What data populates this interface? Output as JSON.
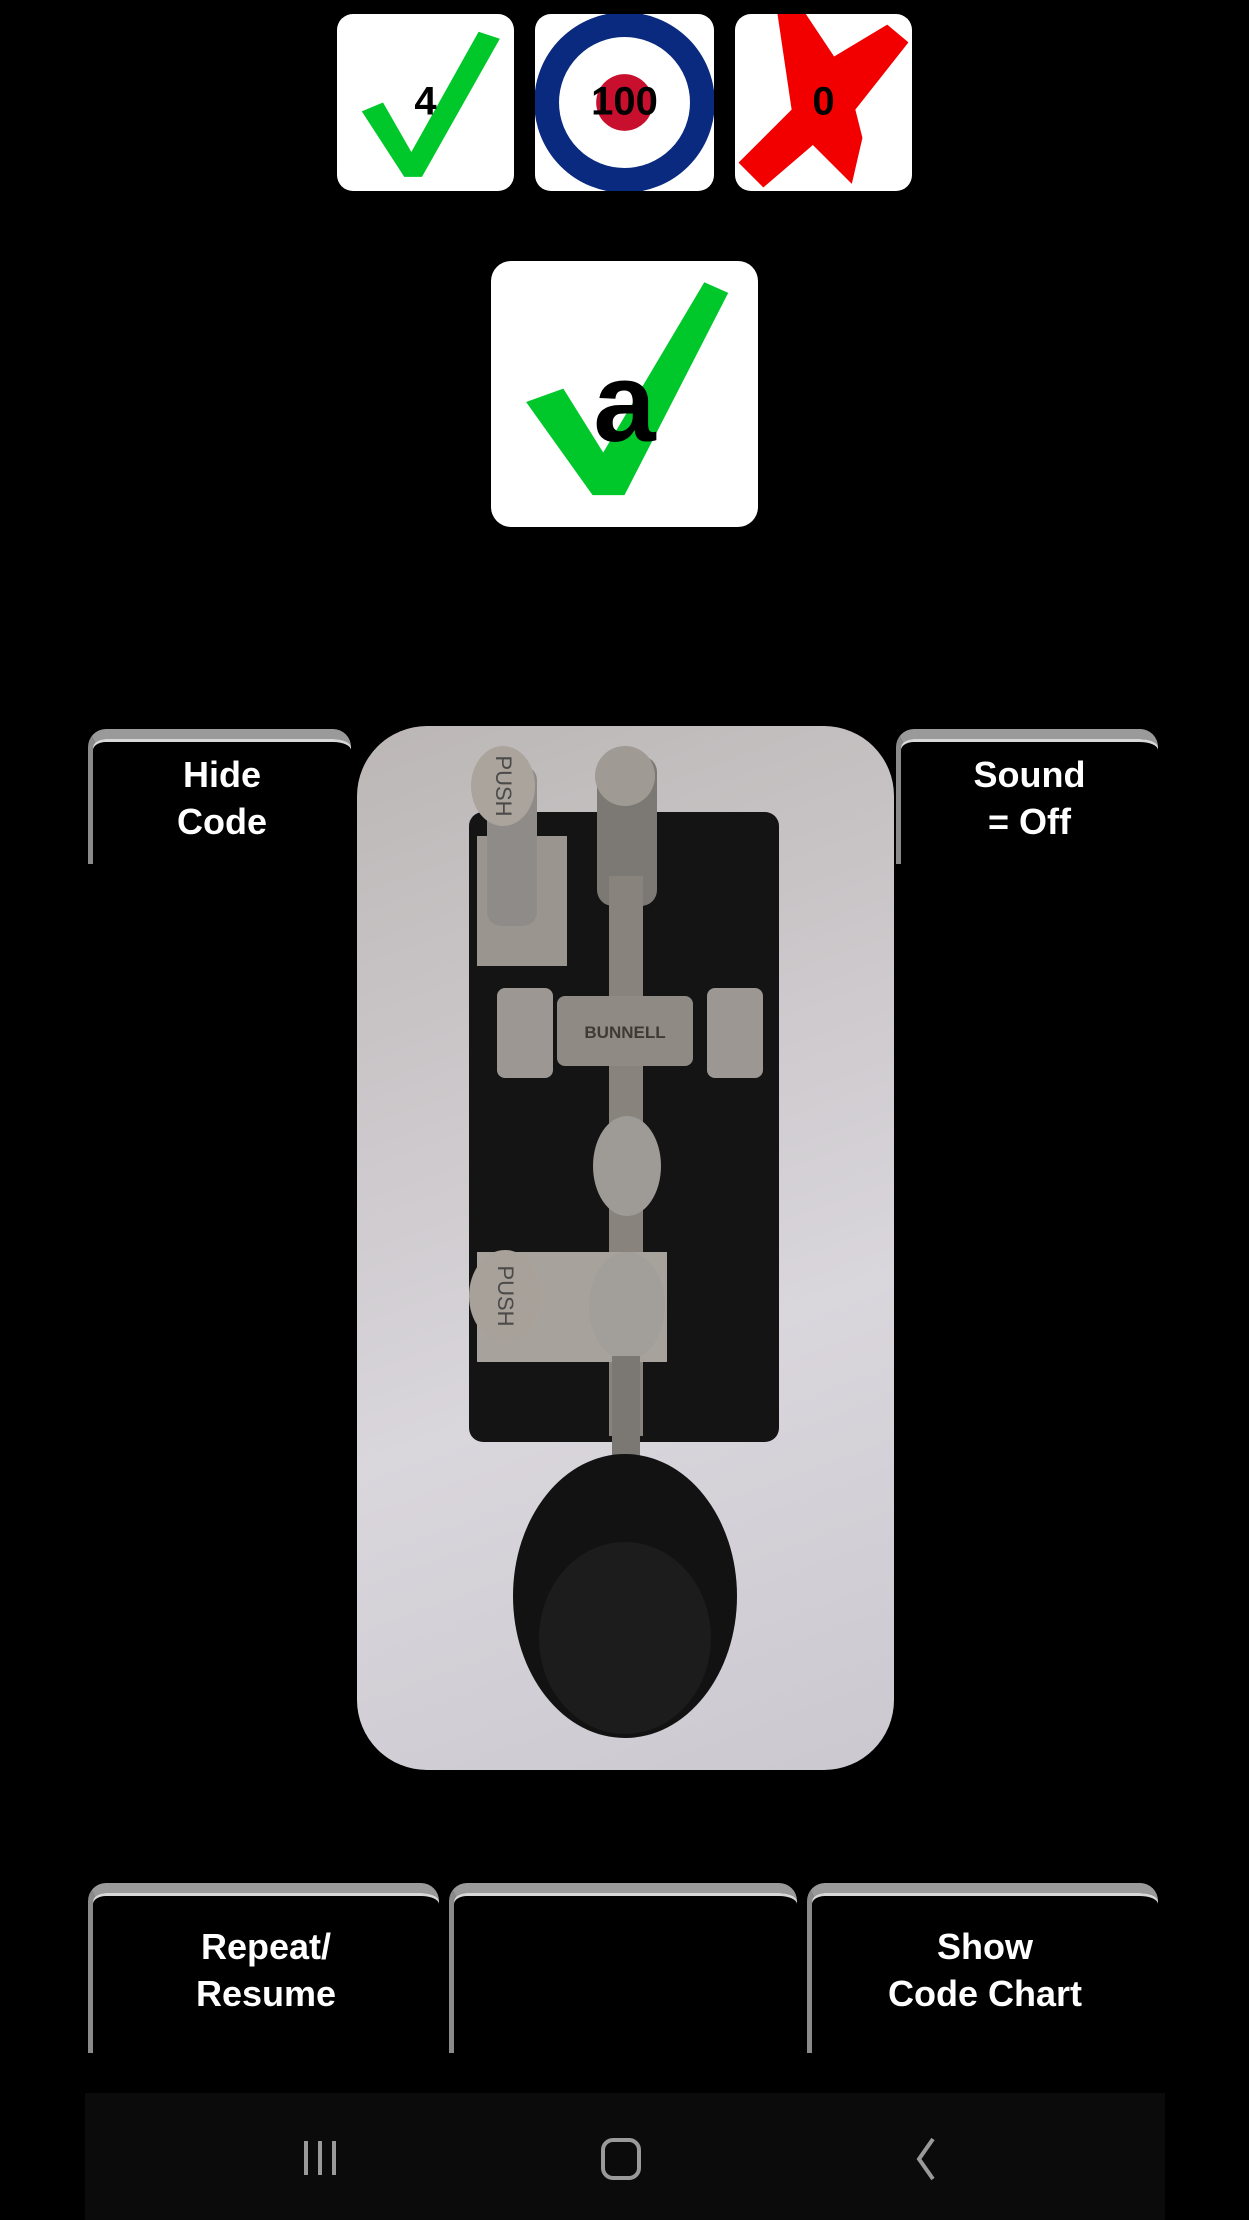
{
  "score": {
    "correct": {
      "icon": "green-check-icon",
      "value": "4"
    },
    "accuracy": {
      "icon": "target-roundel-icon",
      "value": "100"
    },
    "wrong": {
      "icon": "red-x-icon",
      "value": "0"
    }
  },
  "current": {
    "icon": "green-check-icon",
    "letter": "a"
  },
  "buttons": {
    "hide_code": "Hide\nCode",
    "sound": "Sound\n= Off",
    "repeat": "Repeat/\nResume",
    "middle": "",
    "chart": "Show\nCode Chart"
  },
  "key_image": {
    "icon": "telegraph-key-image",
    "labels": [
      "PUSH",
      "BUNNELL",
      "PUSH"
    ]
  },
  "navbar": {
    "recent": "recent-apps-icon",
    "home": "home-icon",
    "back": "back-icon"
  },
  "colors": {
    "check": "#00c82a",
    "cross": "#f20000",
    "roundel_blue": "#0a2a80",
    "roundel_red": "#c8102e",
    "button_bevel": "#9a9a9a"
  }
}
